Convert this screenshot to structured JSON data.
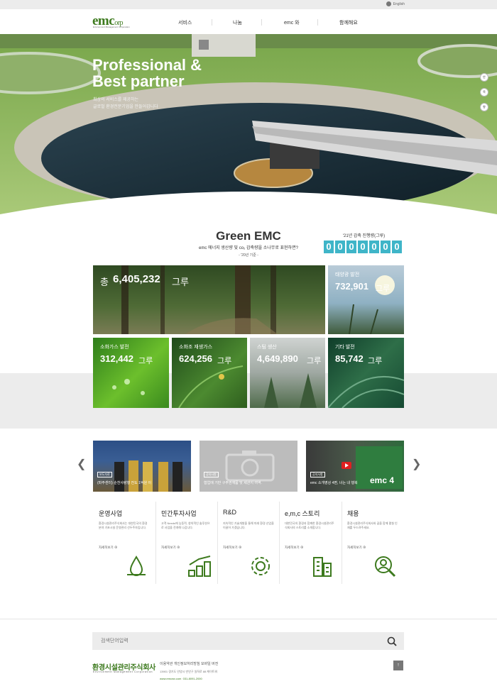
{
  "topbar": {
    "lang_label": "English"
  },
  "header": {
    "logo_main": "emc",
    "logo_suffix": "orp",
    "logo_sub": "Environment Management Corporation",
    "menu": [
      "서비스",
      "나눔",
      "emc 와",
      "함께해요"
    ]
  },
  "hero": {
    "title_line1": "Professional &",
    "title_line2": "Best partner",
    "subtitle_line1": "최상의 서비스를 제공하는",
    "subtitle_line2": "글로벌 환경전문기업을 만들어갑니다",
    "indicators": [
      "안",
      "목",
      "향"
    ]
  },
  "green": {
    "title": "Green EMC",
    "subtitle": "emc 에너지 생산량 및 co₂ 감축량을 소나무로 표현하면?",
    "base": "- '20년 기준 -",
    "counter_label": "'21년 감축 진행량(그루)",
    "counter_digits": [
      "0",
      "0",
      "0",
      "0",
      "0",
      "0",
      "0"
    ]
  },
  "stats": {
    "total": {
      "label": "총",
      "value": "6,405,232",
      "unit": "그루"
    },
    "solar": {
      "label": "태양광 발전",
      "value": "732,901",
      "unit": "그루"
    },
    "digestion": {
      "label": "소화가스 발전",
      "value": "312,442",
      "unit": "그루"
    },
    "algae": {
      "label": "소화조 재생가스",
      "value": "624,256",
      "unit": "그루"
    },
    "steam": {
      "label": "스팀 생산",
      "value": "4,649,890",
      "unit": "그루"
    },
    "other": {
      "label": "기타 발전",
      "value": "85,742",
      "unit": "그루"
    }
  },
  "news": [
    {
      "tag": "보도자료",
      "caption": "(파주센터) 순천사랑행 전도 1억원 이"
    },
    {
      "tag": "공지사항",
      "caption": "협업에 기반 구주권재품 및 세관지 여역."
    },
    {
      "tag": "공지사항",
      "caption": "emc 소개영상 4편, 너는 내 행복"
    }
  ],
  "business": [
    {
      "title": "운영사업",
      "desc": "환경시설관리주식회사는 대한민국의 환경분야 기초시설 운영관리 선두주자입니다.",
      "more": "자세히보기",
      "icon": "water-drop-icon"
    },
    {
      "title": "민간투자사업",
      "desc": "고객 Needs에 능동적, 창의적인 솔루션으로 사업을 전개해 나갑니다.",
      "more": "자세히보기",
      "icon": "growth-coins-icon"
    },
    {
      "title": "R&D",
      "desc": "지속적인 기술개발을 통해 미래 환경 산업을 이끌어 가겠습니다.",
      "more": "자세히보기",
      "icon": "gear-recycle-icon"
    },
    {
      "title": "e,m,c 스토리",
      "desc": "대한민국의 환경과 함께한 환경시설관리주식회사의 스토리를 소개합니다.",
      "more": "자세히보기",
      "icon": "buildings-icon"
    },
    {
      "title": "채용",
      "desc": "환경시설관리주식회사와 꿈을 함께 펼칠 인재를 두드려주세요.",
      "more": "자세히보기",
      "icon": "person-search-icon"
    }
  ],
  "footer": {
    "search_placeholder": "검색단어입력",
    "company_name": "환경시설관리주식회사",
    "company_en": "Environment Management Corporation",
    "links": "이용약관   개인정보처리방침   모바일 버전",
    "address": "13901 경기도 안양시 만안구 일직로 88 케이트워",
    "url": "www.emcwv.com",
    "phone": "031-8091-2000"
  },
  "colors": {
    "brand_green": "#3d7a1e",
    "counter_cyan": "#3fb5c8"
  }
}
